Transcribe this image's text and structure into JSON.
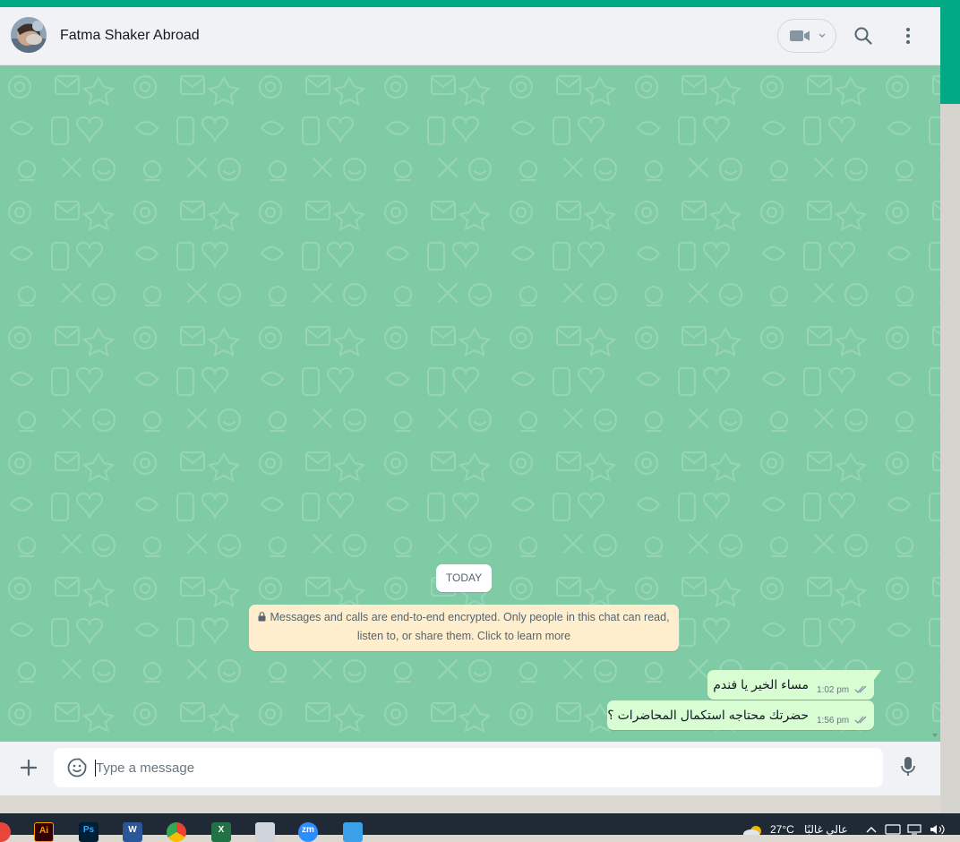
{
  "header": {
    "contact_name": "Fatma Shaker Abroad"
  },
  "chat": {
    "date_divider": "TODAY",
    "encryption_notice_line1": "Messages and calls are end-to-end encrypted. Only people in this chat can read,",
    "encryption_notice_line2": "listen to, or share them. Click to learn more",
    "messages": [
      {
        "text": "مساء الخير يا فندم",
        "time": "1:02 pm",
        "status": "delivered"
      },
      {
        "text": "حضرتك محتاجه استكمال المحاضرات ؟",
        "time": "1:56 pm",
        "status": "delivered"
      }
    ]
  },
  "composer": {
    "placeholder": "Type a message"
  },
  "taskbar": {
    "apps": [
      {
        "name": "chrome-partial",
        "label": ""
      },
      {
        "name": "illustrator",
        "label": "Ai"
      },
      {
        "name": "photoshop",
        "label": "Ps"
      },
      {
        "name": "word",
        "label": "W"
      },
      {
        "name": "chrome",
        "label": ""
      },
      {
        "name": "excel",
        "label": "X"
      },
      {
        "name": "printer",
        "label": ""
      },
      {
        "name": "zoom",
        "label": "zm"
      },
      {
        "name": "photos",
        "label": ""
      }
    ],
    "weather": "27°C",
    "weather_desc": "عالي غالبًا"
  },
  "colors": {
    "accent": "#00a884",
    "chat_bg": "#7fcba5",
    "outgoing_bubble": "#d9fdd3",
    "system_bubble": "#ffeecd",
    "header_bg": "#f0f2f5"
  }
}
